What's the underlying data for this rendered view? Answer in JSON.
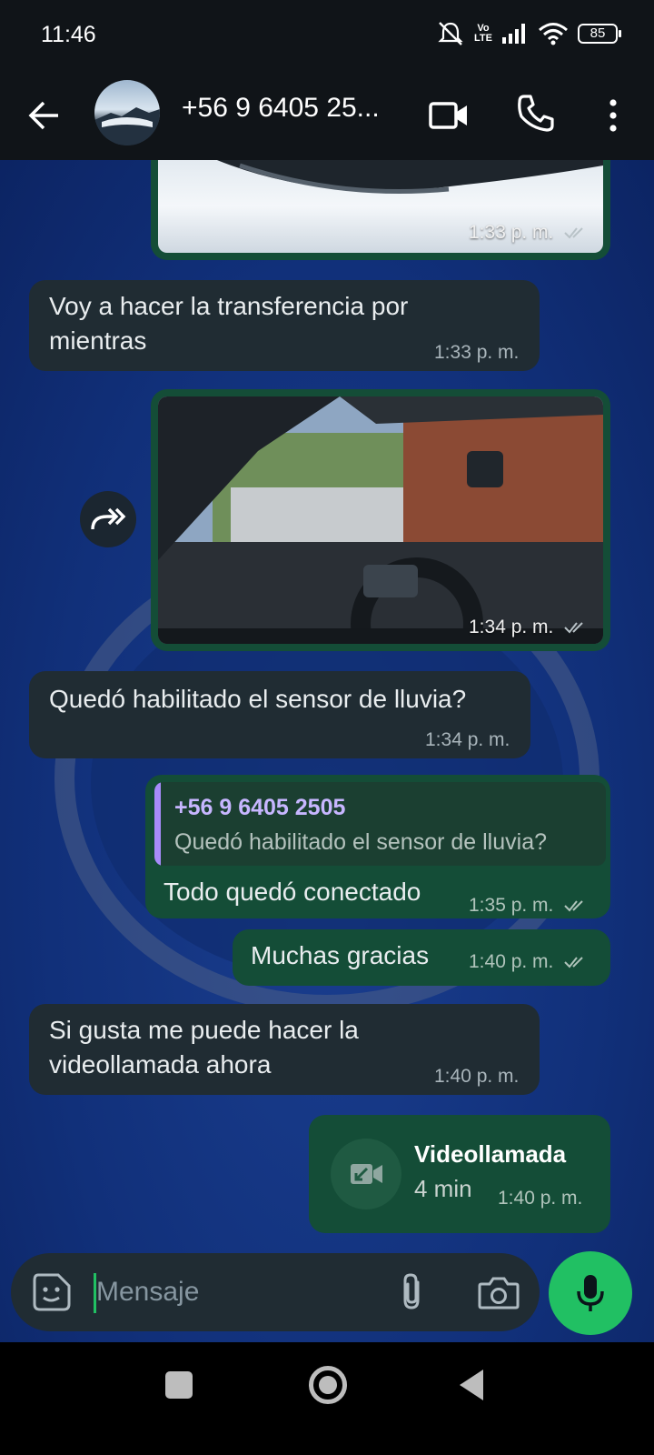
{
  "status_bar": {
    "time": "11:46",
    "volte_top": "Vo",
    "volte_bottom": "LTE",
    "battery": "85",
    "icons": [
      "mute-icon",
      "volte-icon",
      "signal-icon",
      "wifi-icon",
      "battery-icon"
    ]
  },
  "header": {
    "contact": "+56 9 6405 25...",
    "icons": [
      "back-arrow-icon",
      "video-call-icon",
      "phone-icon",
      "more-vert-icon"
    ]
  },
  "messages": [
    {
      "type": "image",
      "direction": "out",
      "time": "1:33 p. m.",
      "status": "read"
    },
    {
      "type": "text",
      "direction": "in",
      "text_line1": "Voy a hacer la transferencia por",
      "text_line2": "mientras",
      "time": "1:33 p. m."
    },
    {
      "type": "image",
      "direction": "out",
      "time": "1:34 p. m.",
      "status": "read"
    },
    {
      "type": "text",
      "direction": "in",
      "text": "Quedó habilitado el sensor de lluvia?",
      "time": "1:34 p. m."
    },
    {
      "type": "reply",
      "direction": "out",
      "quoted_name": "+56 9 6405 2505",
      "quoted_text": "Quedó habilitado el sensor de lluvia?",
      "text": "Todo quedó conectado",
      "time": "1:35 p. m.",
      "status": "read"
    },
    {
      "type": "text",
      "direction": "out",
      "text": "Muchas gracias",
      "time": "1:40 p. m.",
      "status": "read"
    },
    {
      "type": "text",
      "direction": "in",
      "text_line1": "Si gusta me puede hacer la",
      "text_line2": "videollamada ahora",
      "time": "1:40 p. m."
    },
    {
      "type": "call",
      "direction": "out",
      "title": "Videollamada",
      "duration": "4 min",
      "time": "1:40 p. m."
    }
  ],
  "composer": {
    "placeholder": "Mensaje",
    "icons": [
      "sticker-icon",
      "attach-icon",
      "camera-icon",
      "mic-icon"
    ]
  },
  "colors": {
    "incoming_bubble": "#202c33",
    "outgoing_bubble": "#144d37",
    "accent": "#21c063",
    "header_bg": "#101418"
  }
}
